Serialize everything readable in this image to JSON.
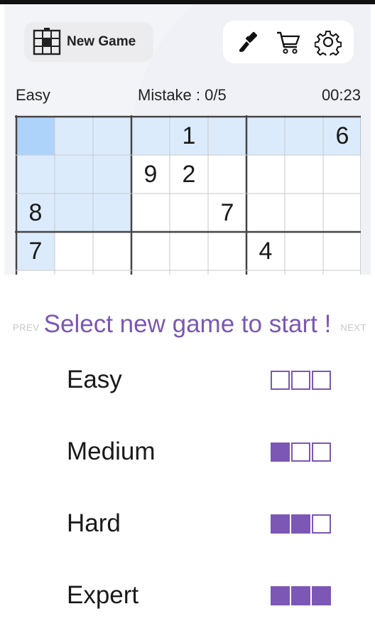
{
  "header": {
    "new_game_label": "New Game",
    "icons": [
      "sudoku-grid-icon",
      "brush-icon",
      "cart-icon",
      "gear-icon"
    ]
  },
  "status": {
    "difficulty": "Easy",
    "mistakes": "Mistake : 0/5",
    "timer": "00:23"
  },
  "board": {
    "rows": [
      [
        "",
        "",
        "",
        "",
        "1",
        "",
        "",
        "",
        "6"
      ],
      [
        "",
        "",
        "",
        "9",
        "2",
        "",
        "",
        "",
        ""
      ],
      [
        "8",
        "",
        "",
        "",
        "",
        "7",
        "",
        "",
        ""
      ],
      [
        "7",
        "",
        "",
        "",
        "",
        "",
        "4",
        "",
        ""
      ]
    ],
    "selected_cell": [
      0,
      0
    ]
  },
  "new_game_sheet": {
    "title": "Select new game to start !",
    "prev_label": "PREV",
    "next_label": "NEXT",
    "levels": [
      {
        "name": "Easy",
        "filled": 0
      },
      {
        "name": "Medium",
        "filled": 1
      },
      {
        "name": "Hard",
        "filled": 2
      },
      {
        "name": "Expert",
        "filled": 3
      }
    ]
  },
  "colors": {
    "accent": "#7c57b5",
    "selected_cell": "#aed3fb",
    "highlight_cell": "#dcebfb"
  }
}
